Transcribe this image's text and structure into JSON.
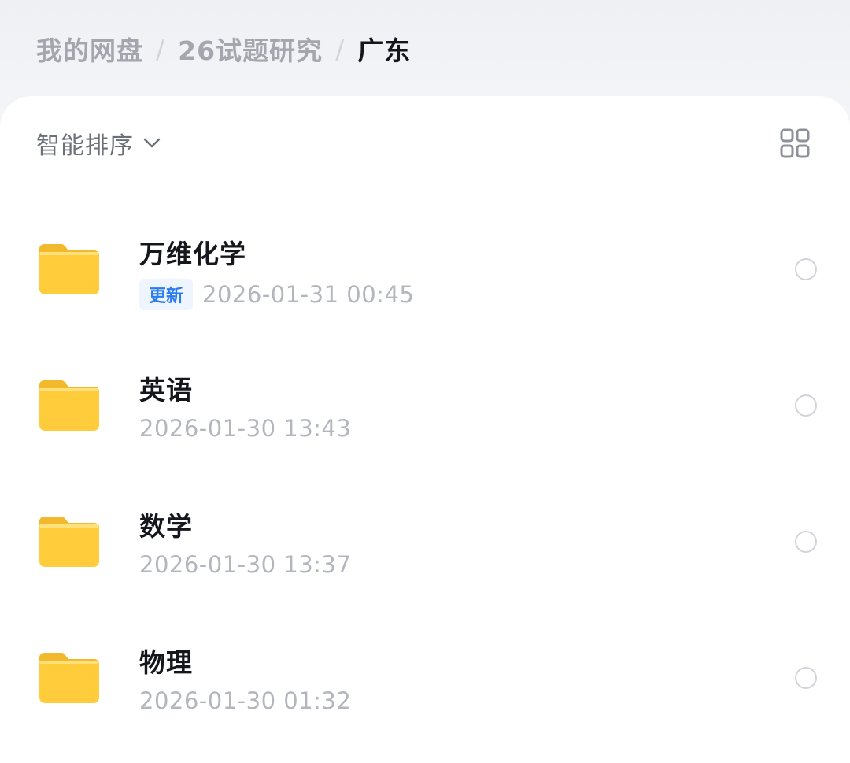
{
  "breadcrumb": {
    "items": [
      "我的网盘",
      "26试题研究",
      "广东"
    ],
    "separator": "/"
  },
  "toolbar": {
    "sort_label": "智能排序",
    "sort_icon": "chevron-down-icon",
    "view_toggle_icon": "grid-view-icon"
  },
  "colors": {
    "folder": "#ffce3d",
    "badge_text": "#2b7bf0",
    "badge_bg": "#eef5ff"
  },
  "files": [
    {
      "name": "万维化学",
      "badge": "更新",
      "time": "2026-01-31 00:45",
      "icon": "folder-icon"
    },
    {
      "name": "英语",
      "time": "2026-01-30 13:43",
      "icon": "folder-icon"
    },
    {
      "name": "数学",
      "time": "2026-01-30 13:37",
      "icon": "folder-icon"
    },
    {
      "name": "物理",
      "time": "2026-01-30 01:32",
      "icon": "folder-icon"
    }
  ]
}
